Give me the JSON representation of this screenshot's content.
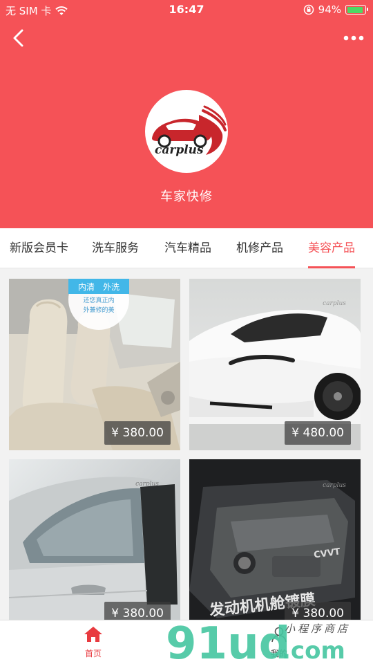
{
  "status_bar": {
    "carrier": "无 SIM 卡",
    "time": "16:47",
    "battery": "94%",
    "battery_level": 0.94
  },
  "header": {
    "logo_text": "carplus",
    "shop_name": "车家快修",
    "accent": "#f55257"
  },
  "tabs": [
    {
      "label": "新版会员卡",
      "active": false
    },
    {
      "label": "洗车服务",
      "active": false
    },
    {
      "label": "汽车精品",
      "active": false
    },
    {
      "label": "机修产品",
      "active": false
    },
    {
      "label": "美容产品",
      "active": true
    }
  ],
  "products": [
    {
      "price": "¥ 380.00",
      "badge_top": "内清　外洗",
      "badge_line1": "还您真正内",
      "badge_line2": "外兼修的美"
    },
    {
      "price": "¥ 480.00",
      "image_logo": "carplus"
    },
    {
      "price": "¥ 380.00",
      "image_logo": "carplus"
    },
    {
      "price": "¥ 380.00",
      "image_logo": "carplus",
      "overlay_text": "发动机机舱镀膜",
      "engine_mark": "CVVT"
    }
  ],
  "bottom_nav": [
    {
      "label": "首页",
      "icon": "home-icon",
      "active": true
    },
    {
      "label": "我的",
      "icon": "user-icon",
      "active": false
    }
  ],
  "watermark": {
    "brand": "91ud",
    "suffix": ".com",
    "tagline": "小程序商店"
  }
}
